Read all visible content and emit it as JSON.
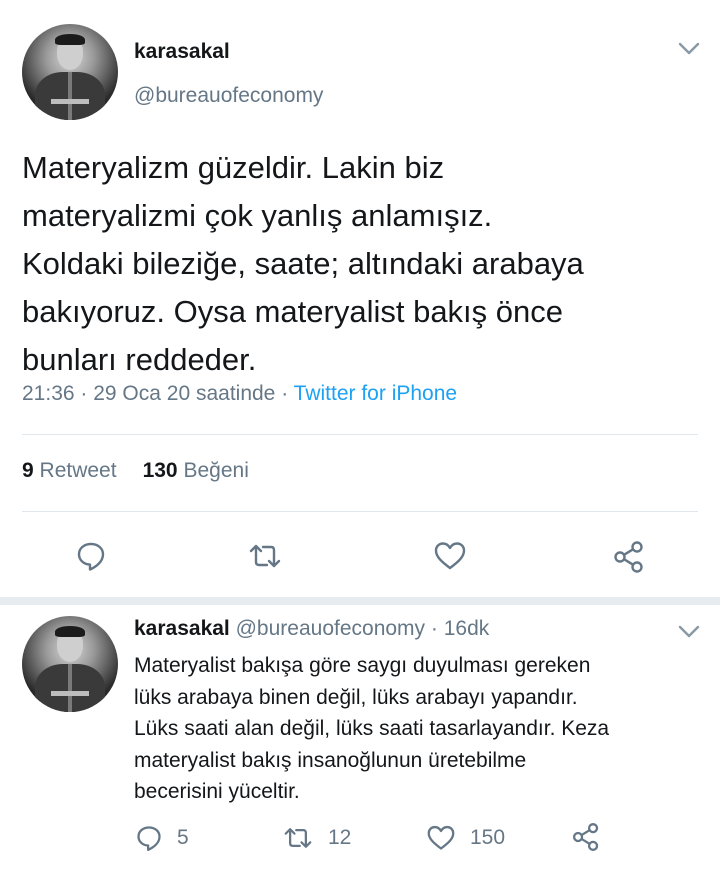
{
  "tweet": {
    "author_name": "karasakal",
    "author_handle": "@bureauofeconomy",
    "text_lines": [
      "Materyalizm güzeldir. Lakin biz",
      "materyalizmi çok yanlış anlamışız.",
      "Koldaki bileziğe, saate; altındaki arabaya",
      "bakıyoruz. Oysa materyalist bakış önce",
      "bunları reddeder."
    ],
    "time": "21:36",
    "date": "29 Oca 20 saatinde",
    "source": "Twitter for iPhone",
    "separator": " · ",
    "retweet_count": "9",
    "retweet_label": "Retweet",
    "like_count": "130",
    "like_label": "Beğeni"
  },
  "reply": {
    "author_name": "karasakal",
    "author_handle": "@bureauofeconomy",
    "age": "16dk",
    "separator": " · ",
    "text_lines": [
      "Materyalist bakışa göre saygı duyulması gereken",
      "lüks arabaya binen değil, lüks arabayı yapandır.",
      "Lüks saati alan değil, lüks saati tasarlayandır. Keza",
      "materyalist bakış insanoğlunun üretebilme",
      "becerisini yüceltir."
    ],
    "reply_count": "5",
    "retweet_count": "12",
    "like_count": "150"
  },
  "icons": {
    "reply": "comment-icon",
    "retweet": "retweet-icon",
    "like": "heart-icon",
    "share": "share-icon",
    "caret": "chevron-down-icon"
  },
  "colors": {
    "text": "#14171a",
    "secondary": "#657786",
    "accent": "#1da1f2",
    "divider": "#e1e8ed"
  }
}
